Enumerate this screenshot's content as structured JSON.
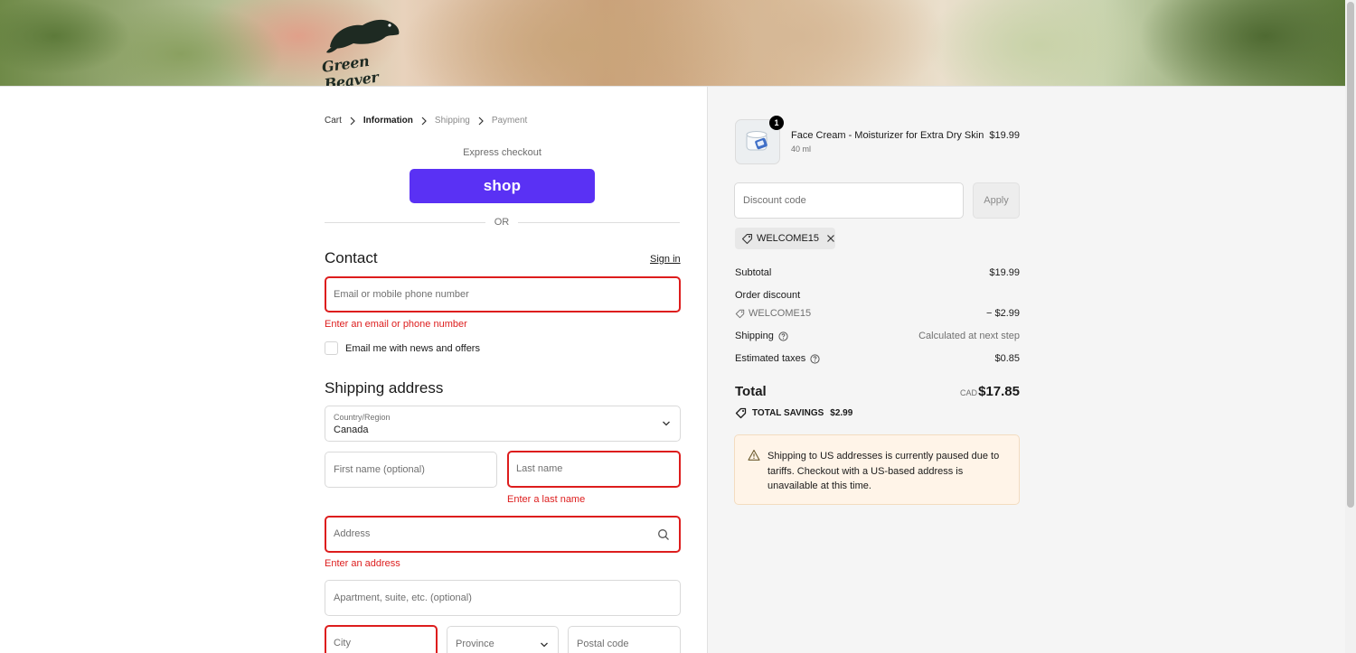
{
  "header": {
    "logo_text": "Green Beaver"
  },
  "breadcrumb": [
    {
      "label": "Cart"
    },
    {
      "label": "Information"
    },
    {
      "label": "Shipping"
    },
    {
      "label": "Payment"
    }
  ],
  "express": {
    "label": "Express checkout",
    "shop_button": "shop",
    "or_label": "OR"
  },
  "contact": {
    "title": "Contact",
    "signin_link": "Sign in",
    "email_placeholder": "Email or mobile phone number",
    "email_error": "Enter an email or phone number",
    "newsletter_label": "Email me with news and offers"
  },
  "shipping": {
    "title": "Shipping address",
    "country_label": "Country/Region",
    "country_value": "Canada",
    "first_name_placeholder": "First name (optional)",
    "last_name_placeholder": "Last name",
    "last_name_error": "Enter a last name",
    "address_placeholder": "Address",
    "address_error": "Enter an address",
    "apartment_placeholder": "Apartment, suite, etc. (optional)",
    "city_placeholder": "City",
    "province_placeholder": "Province",
    "postal_placeholder": "Postal code"
  },
  "summary": {
    "product": {
      "quantity": "1",
      "name": "Face Cream - Moisturizer for Extra Dry Skin",
      "variant": "40 ml",
      "price": "$19.99"
    },
    "discount_placeholder": "Discount code",
    "apply_label": "Apply",
    "applied_code": "WELCOME15",
    "subtotal_label": "Subtotal",
    "subtotal_value": "$19.99",
    "order_discount_label": "Order discount",
    "discount_code": "WELCOME15",
    "discount_value": "− $2.99",
    "shipping_label": "Shipping",
    "shipping_value": "Calculated at next step",
    "taxes_label": "Estimated taxes",
    "taxes_value": "$0.85",
    "total_label": "Total",
    "currency": "CAD",
    "total_value": "$17.85",
    "savings_label": "TOTAL SAVINGS",
    "savings_value": "$2.99",
    "notice": "Shipping to US addresses is currently paused due to tariffs. Checkout with a US-based address is unavailable at this time."
  },
  "colors": {
    "shop_purple": "#5a31f4",
    "error_red": "#dd1d1d",
    "notice_bg": "#fff4e8"
  }
}
